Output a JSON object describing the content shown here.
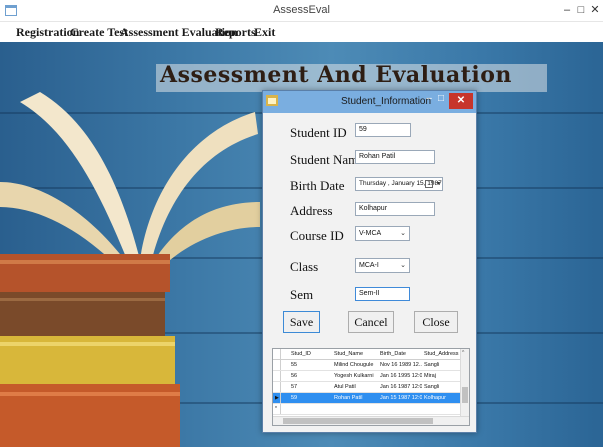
{
  "window": {
    "title": "AssessEval",
    "minimize": "–",
    "maximize": "□",
    "close": "✕"
  },
  "menu": {
    "items": [
      "Registration",
      "Create Test",
      "Assessment Evaluation",
      "Reports",
      "Exit"
    ]
  },
  "banner": {
    "title": "Assessment And Evaluation"
  },
  "dialog": {
    "title": "Student_Information",
    "minimize": "–",
    "maximize": "□",
    "close": "✕",
    "labels": {
      "student_id": "Student ID",
      "student_name": "Student Name",
      "birth_date": "Birth Date",
      "address": "Address",
      "course_id": "Course ID",
      "class": "Class",
      "sem": "Sem"
    },
    "values": {
      "student_id": "59",
      "student_name": "Rohan Patil",
      "birth_date": "Thursday  ,  January  15, 1987",
      "address": "Kolhapur",
      "course_id": "V-MCA",
      "class": "MCA-I",
      "sem": "Sem-II"
    },
    "buttons": {
      "save": "Save",
      "cancel": "Cancel",
      "close": "Close"
    },
    "grid": {
      "columns": [
        "Stud_ID",
        "Stud_Name",
        "Birth_Date",
        "Stud_Address"
      ],
      "rows": [
        [
          "55",
          "Milind Chougule",
          "Nov 16 1989 12...",
          "Sangli"
        ],
        [
          "56",
          "Yogesh Kulkarni",
          "Jan 16 1995 12:0...",
          "Miraj"
        ],
        [
          "57",
          "Atul Patil",
          "Jan 16 1987 12:0...",
          "Sangli"
        ],
        [
          "59",
          "Rohan Patil",
          "Jan 15 1987 12:0...",
          "Kolhapur"
        ],
        [
          "",
          "",
          "",
          ""
        ]
      ],
      "selected_row": 3
    }
  },
  "colors": {
    "dialog_title_bar": "#7aaee0",
    "close_button": "#c7352b",
    "selected_row": "#2f8ff0"
  }
}
